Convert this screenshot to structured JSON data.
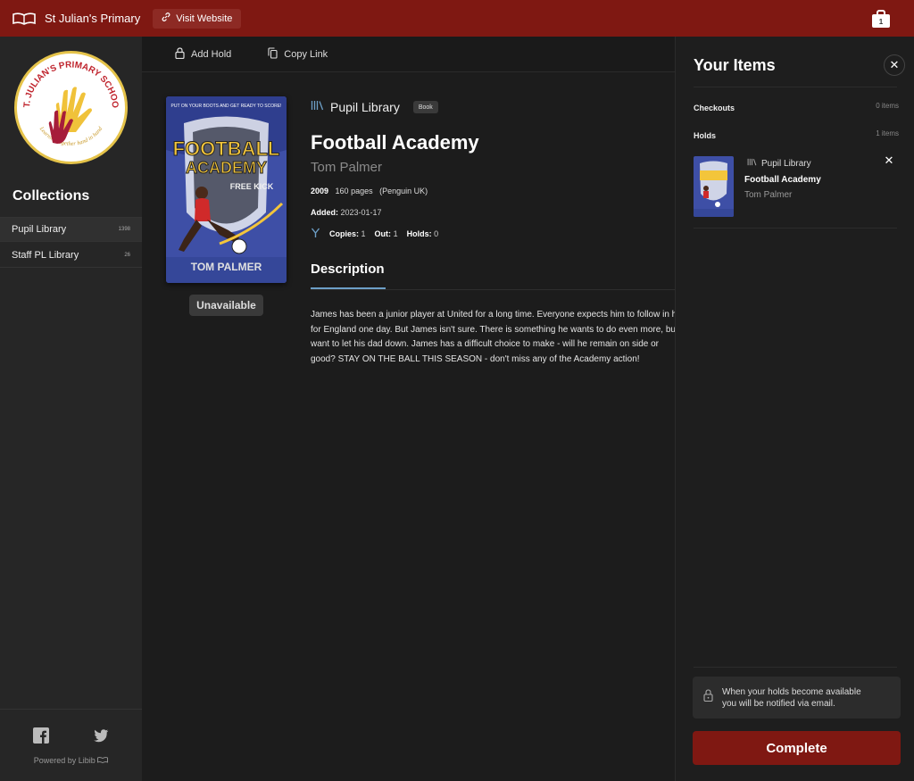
{
  "topbar": {
    "school_name": "St Julian's Primary",
    "visit_label": "Visit Website",
    "cart_count": "1",
    "brand_color": "#7f1812"
  },
  "sidebar": {
    "logo_text": "ST. JULIAN'S PRIMARY SCHOOL",
    "logo_motto": "Learning together hand in hand",
    "collections_title": "Collections",
    "collections": [
      {
        "label": "Pupil Library",
        "count": "1398"
      },
      {
        "label": "Staff PL Library",
        "count": "26"
      }
    ],
    "powered_by": "Powered by Libib"
  },
  "toolbar": {
    "add_hold": "Add Hold",
    "copy_link": "Copy Link"
  },
  "book": {
    "cover_top_text": "PUT ON YOUR BOOTS AND GET READY TO SCORE!",
    "cover_title_line1": "FOOTBALL",
    "cover_title_line2": "ACADEMY",
    "cover_subtitle": "FREE KICK",
    "cover_author": "TOM PALMER",
    "status": "Unavailable",
    "library": "Pupil Library",
    "type": "Book",
    "title": "Football Academy",
    "author": "Tom Palmer",
    "year": "2009",
    "pages": "160 pages",
    "publisher": "(Penguin UK)",
    "added_label": "Added:",
    "added_date": "2023-01-17",
    "copies_label": "Copies:",
    "copies": "1",
    "out_label": "Out:",
    "out": "1",
    "holds_label": "Holds:",
    "holds": "0",
    "description_tab": "Description",
    "description_lines": [
      "James has been a junior player at United for a long time. Everyone expects him to follow in his",
      "for England one day. But James isn't sure. There is something he wants to do even more, but he",
      "want to let his dad down. James has a difficult choice to make - will he remain on side or",
      "good? STAY ON THE BALL THIS SEASON - don't miss any of the Academy action!"
    ]
  },
  "panel": {
    "title": "Your Items",
    "checkouts_label": "Checkouts",
    "checkouts_count": "0 items",
    "holds_label": "Holds",
    "holds_count": "1 items",
    "hold_item": {
      "library": "Pupil Library",
      "title": "Football Academy",
      "author": "Tom Palmer"
    },
    "notice_line1": "When your holds become available",
    "notice_line2": "you will be notified via email.",
    "complete_label": "Complete"
  }
}
